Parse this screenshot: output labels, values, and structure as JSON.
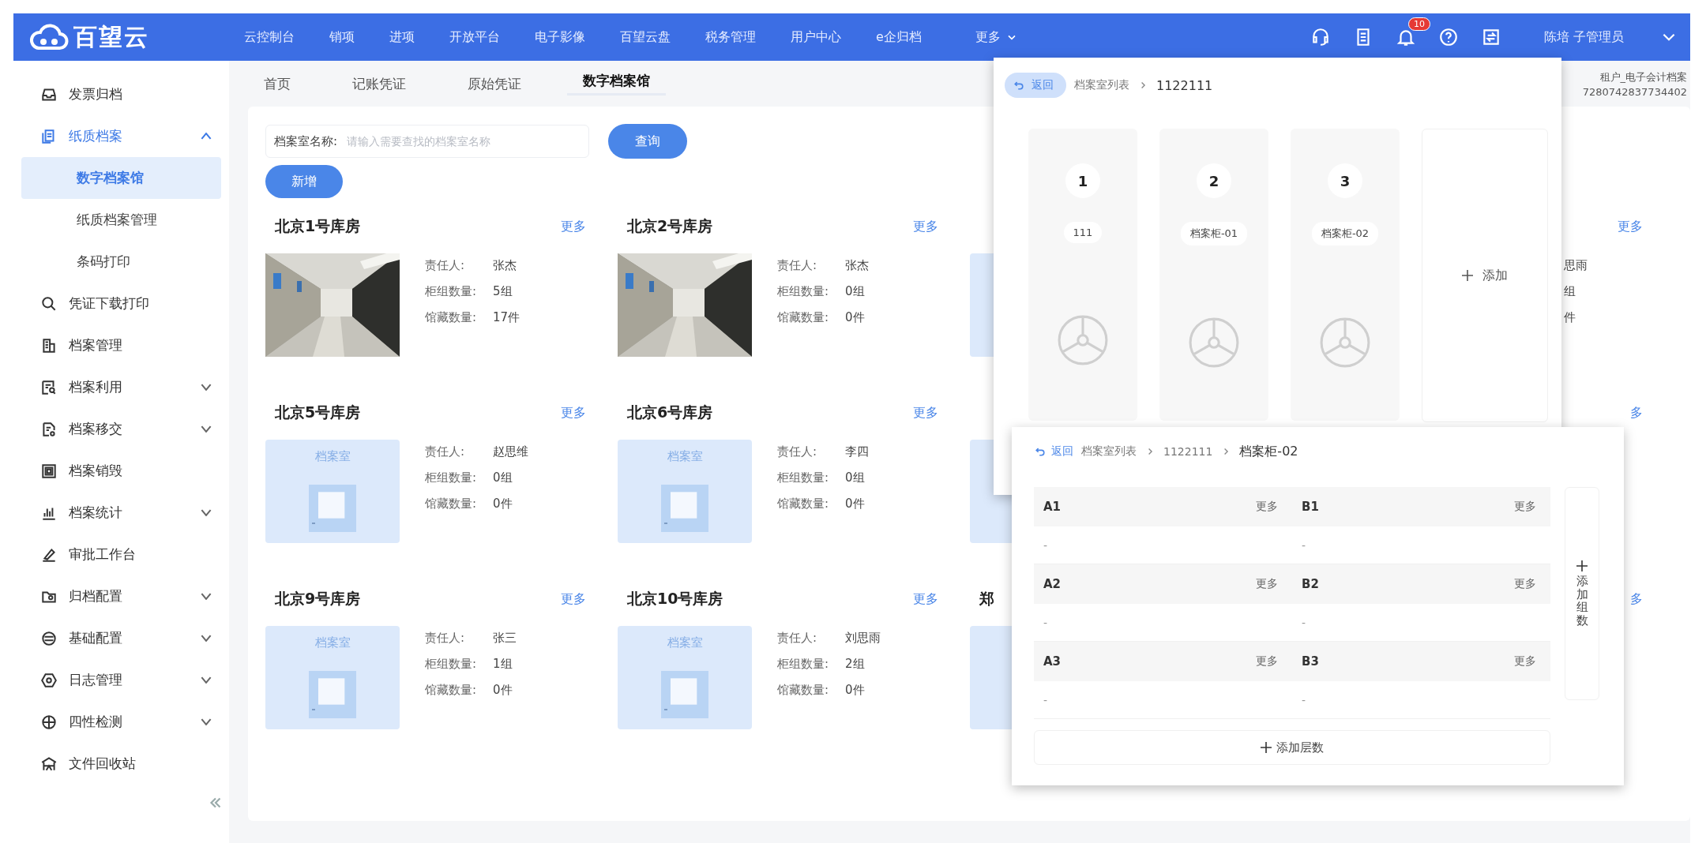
{
  "top_bar": {
    "logo": "百望云",
    "nav": [
      "云控制台",
      "销项",
      "进项",
      "开放平台",
      "电子影像",
      "百望云盘",
      "税务管理",
      "用户中心",
      "e企归档"
    ],
    "more": "更多",
    "notification_badge": "10",
    "user": "陈培 子管理员"
  },
  "account": {
    "line_1": "租户_电子会计档案",
    "line_2": "7280742837734402"
  },
  "tabs": [
    {
      "label": "首页",
      "selected": false
    },
    {
      "label": "记账凭证",
      "selected": false
    },
    {
      "label": "原始凭证",
      "selected": false
    },
    {
      "label": "数字档案馆",
      "selected": true
    }
  ],
  "sidebar": {
    "items": [
      {
        "label": "发票归档",
        "selected": false
      },
      {
        "label": "纸质档案",
        "selected": false,
        "expanded": true,
        "children": [
          {
            "label": "数字档案馆",
            "selected": true
          },
          {
            "label": "纸质档案管理",
            "selected": false
          },
          {
            "label": "条码打印",
            "selected": false
          }
        ]
      },
      {
        "label": "凭证下载打印",
        "selected": false
      },
      {
        "label": "档案管理",
        "selected": false
      },
      {
        "label": "档案利用",
        "selected": false,
        "expanded": false
      },
      {
        "label": "档案移交",
        "selected": false,
        "expanded": false
      },
      {
        "label": "档案销毁",
        "selected": false
      },
      {
        "label": "档案统计",
        "selected": false,
        "expanded": false
      },
      {
        "label": "审批工作台",
        "selected": false
      },
      {
        "label": "归档配置",
        "selected": false,
        "expanded": false
      },
      {
        "label": "基础配置",
        "selected": false,
        "expanded": false
      },
      {
        "label": "日志管理",
        "selected": false,
        "expanded": false
      },
      {
        "label": "四性检测",
        "selected": false,
        "expanded": false
      },
      {
        "label": "文件回收站",
        "selected": false
      }
    ]
  },
  "search": {
    "label": "档案室名称:",
    "placeholder": "请输入需要查找的档案室名称",
    "button": "查询"
  },
  "add_button": "新增",
  "cards": [
    {
      "title": "北京1号库房",
      "more": "更多",
      "image": {
        "kind": "picture"
      },
      "details": [
        {
          "label": "责任人:",
          "value": "张杰"
        },
        {
          "label": "柜组数量:",
          "value": "5组"
        },
        {
          "label": "馆藏数量:",
          "value": "17件"
        }
      ]
    },
    {
      "title": "北京2号库房",
      "more": "更多",
      "image": {
        "kind": "picture"
      },
      "details": [
        {
          "label": "责任人:",
          "value": "张杰"
        },
        {
          "label": "柜组数量:",
          "value": "0组"
        },
        {
          "label": "馆藏数量:",
          "value": "0件"
        }
      ]
    },
    {
      "image": {
        "kind": "placeholder"
      }
    },
    {
      "more": "更多",
      "details": [
        {
          "value": "思雨"
        },
        {
          "value": "组"
        },
        {
          "value": "件"
        }
      ]
    },
    {
      "title": "北京5号库房",
      "more": "更多",
      "image": {
        "kind": "placeholder",
        "label": "档案室"
      },
      "details": [
        {
          "label": "责任人:",
          "value": "赵思维"
        },
        {
          "label": "柜组数量:",
          "value": "0组"
        },
        {
          "label": "馆藏数量:",
          "value": "0件"
        }
      ]
    },
    {
      "title": "北京6号库房",
      "more": "更多",
      "image": {
        "kind": "placeholder",
        "label": "档案室"
      },
      "details": [
        {
          "label": "责任人:",
          "value": "李四"
        },
        {
          "label": "柜组数量:",
          "value": "0组"
        },
        {
          "label": "馆藏数量:",
          "value": "0件"
        }
      ]
    },
    {
      "image": {
        "kind": "placeholder"
      }
    },
    {
      "more": "多"
    },
    {
      "title": "北京9号库房",
      "more": "更多",
      "image": {
        "kind": "placeholder",
        "label": "档案室"
      },
      "details": [
        {
          "label": "责任人:",
          "value": "张三"
        },
        {
          "label": "柜组数量:",
          "value": "1组"
        },
        {
          "label": "馆藏数量:",
          "value": "0件"
        }
      ]
    },
    {
      "title": "北京10号库房",
      "more": "更多",
      "image": {
        "kind": "placeholder",
        "label": "档案室"
      },
      "details": [
        {
          "label": "责任人:",
          "value": "刘思雨"
        },
        {
          "label": "柜组数量:",
          "value": "2组"
        },
        {
          "label": "馆藏数量:",
          "value": "0件"
        }
      ]
    },
    {
      "title": "郑",
      "image": {
        "kind": "placeholder"
      }
    },
    {
      "more": "多"
    }
  ],
  "room_panel": {
    "back": "返回",
    "breadcrumb": [
      "档案室列表",
      "1122111"
    ],
    "cabinets": [
      {
        "number": "1",
        "name": "111"
      },
      {
        "number": "2",
        "name": "档案柜-01"
      },
      {
        "number": "3",
        "name": "档案柜-02"
      }
    ],
    "add": "添加"
  },
  "cabinet_panel": {
    "back": "返回",
    "breadcrumb": [
      "档案室列表",
      "1122111",
      "档案柜-02"
    ],
    "cells": [
      {
        "name": "A1",
        "more": "更多",
        "value": "-"
      },
      {
        "name": "B1",
        "more": "更多",
        "value": "-"
      },
      {
        "name": "A2",
        "more": "更多",
        "value": "-"
      },
      {
        "name": "B2",
        "more": "更多",
        "value": "-"
      },
      {
        "name": "A3",
        "more": "更多",
        "value": "-"
      },
      {
        "name": "B3",
        "more": "更多",
        "value": "-"
      }
    ],
    "add_column": "添加组数",
    "add_layer": "添加层数"
  }
}
